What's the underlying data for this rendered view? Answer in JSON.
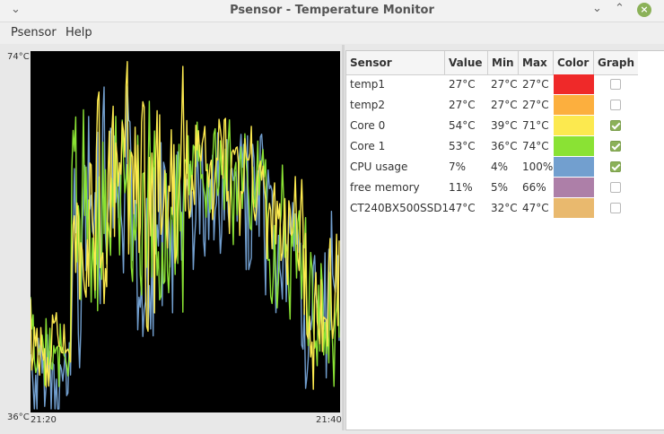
{
  "window": {
    "title": "Psensor - Temperature Monitor",
    "minimize": "⌄",
    "maximize": "⌃",
    "close": "×",
    "menu_chevron": "⌄"
  },
  "menu": {
    "items": [
      "Psensor",
      "Help"
    ]
  },
  "graph": {
    "y_max_label": "74°C",
    "y_min_label": "36°C",
    "x_start_label": "21:20",
    "x_end_label": "21:40"
  },
  "table": {
    "columns": [
      "Sensor",
      "Value",
      "Min",
      "Max",
      "Color",
      "Graph"
    ],
    "rows": [
      {
        "sensor": "temp1",
        "value": "27°C",
        "min": "27°C",
        "max": "27°C",
        "color": "#ef2929",
        "graph": false
      },
      {
        "sensor": "temp2",
        "value": "27°C",
        "min": "27°C",
        "max": "27°C",
        "color": "#fcaf3e",
        "graph": false
      },
      {
        "sensor": "Core 0",
        "value": "54°C",
        "min": "39°C",
        "max": "71°C",
        "color": "#fce94f",
        "graph": true
      },
      {
        "sensor": "Core 1",
        "value": "53°C",
        "min": "36°C",
        "max": "74°C",
        "color": "#8ae234",
        "graph": true
      },
      {
        "sensor": "CPU usage",
        "value": "7%",
        "min": "4%",
        "max": "100%",
        "color": "#729fcf",
        "graph": true
      },
      {
        "sensor": "free memory",
        "value": "11%",
        "min": "5%",
        "max": "66%",
        "color": "#ad7fa8",
        "graph": false
      },
      {
        "sensor": "CT240BX500SSD1",
        "value": "47°C",
        "min": "32°C",
        "max": "47°C",
        "color": "#e9b96e",
        "graph": false
      }
    ]
  }
}
